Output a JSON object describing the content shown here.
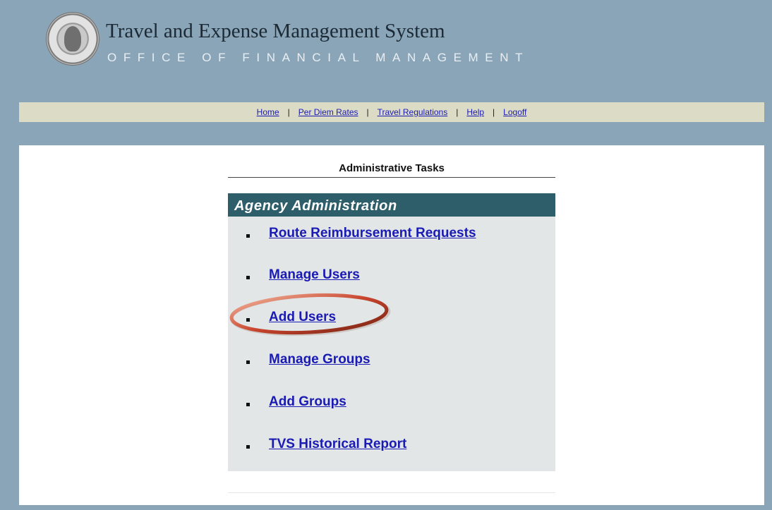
{
  "header": {
    "title": "Travel and Expense Management System",
    "subtitle": "OFFICE OF FINANCIAL MANAGEMENT",
    "seal_icon": "state-seal-icon"
  },
  "nav": {
    "items": [
      "Home",
      "Per Diem Rates",
      "Travel Regulations",
      "Help",
      "Logoff"
    ],
    "separator": "|"
  },
  "panel": {
    "title": "Administrative Tasks",
    "section_header": "Agency Administration",
    "tasks": [
      "Route Reimbursement Requests",
      "Manage Users",
      "Add Users",
      "Manage Groups",
      "Add Groups",
      "TVS Historical Report"
    ],
    "highlighted_task": "Add Users"
  },
  "colors": {
    "page_bg": "#8aa5b8",
    "nav_bg": "#dcdcc6",
    "section_header_bg": "#2d5e6a",
    "link": "#1a1ab4",
    "highlight": "#c8452e"
  }
}
